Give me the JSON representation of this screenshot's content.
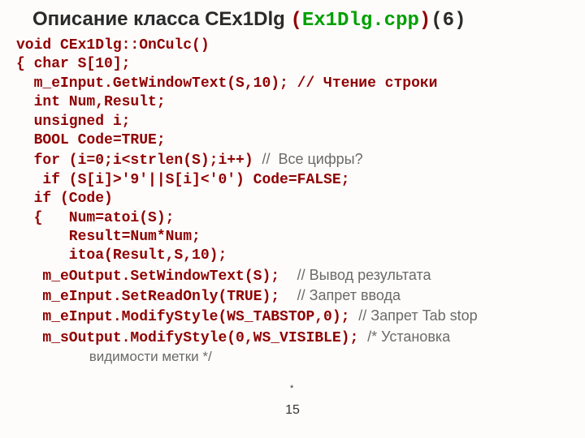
{
  "title": {
    "prefix": "Описание класса CEx1Dlg ",
    "paren_open": "(",
    "file": "Ex1Dlg.cpp",
    "paren_close": ")",
    "num": "(6)"
  },
  "code": {
    "l1": "void CEx1Dlg::OnCulc()",
    "l2": "{ char S[10];",
    "l3a": "  m_eInput.GetWindowText(S,10); ",
    "l3c": "// Чтение строки",
    "l4": "  int Num,Result;",
    "l5": "  unsigned i;",
    "l6": "  BOOL Code=TRUE;",
    "l7a": "  for (i=0;i<strlen(S);i++) ",
    "l7c": "//  Все цифры?",
    "l8": "   if (S[i]>'9'||S[i]<'0') Code=FALSE;",
    "l9": "  if (Code)",
    "l10": "  {   Num=atoi(S);",
    "l11": "      Result=Num*Num;",
    "l12": "      itoa(Result,S,10);",
    "l13a": "   m_eOutput.SetWindowText(S);  ",
    "l13c": "// Вывод результата",
    "l14a": "   m_eInput.SetReadOnly(TRUE);  ",
    "l14c": "// Запрет ввода",
    "l15a": "   m_eInput.ModifyStyle(WS_TABSTOP,0); ",
    "l15c": "// Запрет Tab stop",
    "l16a": "   m_sOutput.ModifyStyle(0,WS_VISIBLE); ",
    "l16c": "/* Установка",
    "l17": "                   видимости метки */"
  },
  "page_number": "15",
  "tick": "*"
}
